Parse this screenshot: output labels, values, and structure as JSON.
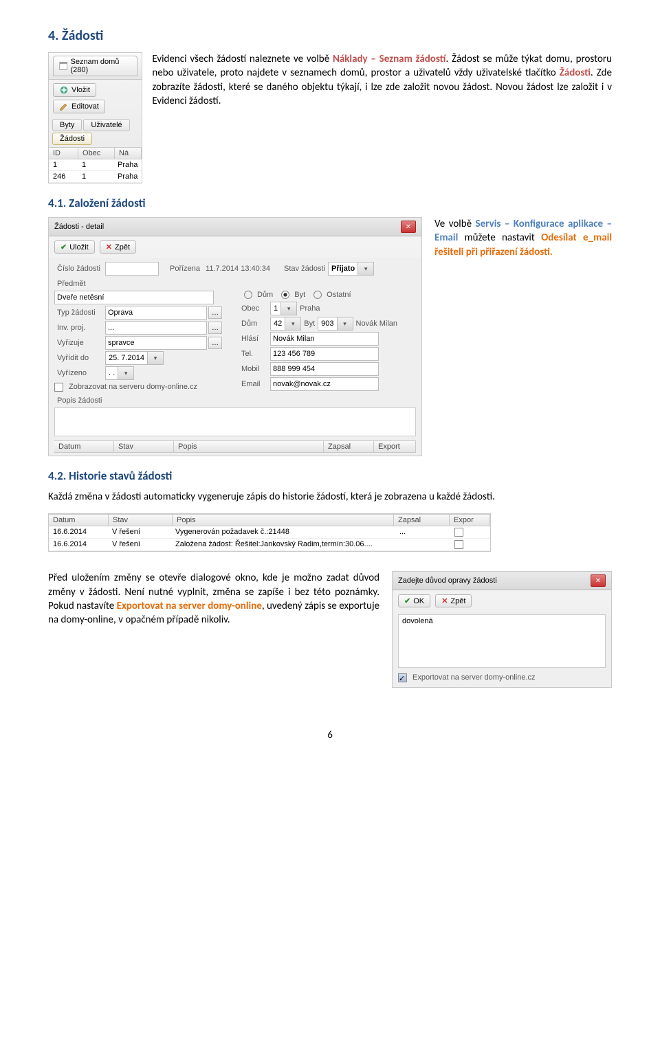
{
  "doc": {
    "h1": "4. Žádosti",
    "p1a": "Evidenci všech žádostí naleznete ve volbě ",
    "p1b": "Náklady – Seznam žádostí",
    "p1c": ". Žádost se může týkat domu, prostoru nebo uživatele, proto najdete v seznamech domů, prostor a uživatelů vždy uživatelské tlačítko ",
    "p1d": "Žádosti",
    "p1e": ". Zde zobrazíte žádosti, které se daného objektu týkají, i lze zde založit novou žádost. Novou žádost lze založit i v Evidenci žádostí.",
    "h2": "4.1. Založení žádosti",
    "p2a": "Ve volbě ",
    "p2b": "Servis – Konfigurace aplikace – Email",
    "p2c": " můžete nastavit ",
    "p2d": "Odesílat e_mail řešiteli při přiřazení žádosti.",
    "h3": "4.2. Historie stavů žádosti",
    "p3": "Každá změna v žádosti automaticky vygeneruje zápis do historie žádostí, která je zobrazena u každé žádosti.",
    "p4a": "Před uložením změny se otevře dialogové okno, kde je možno zadat důvod změny v žádosti. Není nutné vyplnit, změna se zapíše i bez této poznámky. Pokud nastavíte ",
    "p4b": "Exportovat na server domy-online",
    "p4c": ", uvedený zápis se exportuje na domy-online, v opačném případě nikoliv.",
    "pnum": "6"
  },
  "panel": {
    "tabtitle": "Seznam domů (280)",
    "vlozit": "Vložit",
    "editovat": "Editovat",
    "tabs": [
      "Byty",
      "Uživatelé",
      "Žádosti"
    ],
    "sel": 2,
    "cols": [
      "ID",
      "Obec",
      "Ná"
    ],
    "rows": [
      [
        "1",
        "1",
        "Praha"
      ],
      [
        "246",
        "1",
        "Praha"
      ]
    ]
  },
  "detail": {
    "title": "Žádosti - detail",
    "ulozit": "Uložit",
    "zpet": "Zpět",
    "f_cislo_l": "Číslo žádosti",
    "f_cislo_v": "",
    "f_porizena_l": "Pořízena",
    "f_porizena_v": "11.7.2014 13:40:34",
    "f_stav_l": "Stav žádosti",
    "f_stav_v": "Přijato",
    "f_predmet_l": "Předmět",
    "f_predmet_v": "Dveře netěsní",
    "rad_dum": "Dům",
    "rad_byt": "Byt",
    "rad_ost": "Ostatní",
    "f_typ_l": "Typ žádosti",
    "f_typ_v": "Oprava",
    "f_obec_l": "Obec",
    "f_obec_v": "1",
    "f_obec_v2": "Praha",
    "f_inv_l": "Inv. proj.",
    "f_inv_v": "...",
    "f_dum_l": "Dům",
    "f_dum_v": "42",
    "f_byt_l": "Byt",
    "f_byt_v": "903",
    "f_byt_name": "Novák Milan",
    "f_vyrizuje_l": "Vyřizuje",
    "f_vyrizuje_v": "spravce",
    "f_hlasi_l": "Hlásí",
    "f_hlasi_v": "Novák Milan",
    "f_vyridit_l": "Vyřídit do",
    "f_vyridit_v": "25. 7.2014",
    "f_tel_l": "Tel.",
    "f_tel_v": "123 456 789",
    "f_vyrizeno_l": "Vyřízeno",
    "f_vyrizeno_v": ". .",
    "f_mobil_l": "Mobil",
    "f_mobil_v": "888 999 454",
    "chk_zobraz": "Zobrazovat na serveru domy-online.cz",
    "f_email_l": "Email",
    "f_email_v": "novak@novak.cz",
    "popis_l": "Popis žádosti",
    "hcols": [
      "Datum",
      "Stav",
      "Popis",
      "Zapsal",
      "Export"
    ]
  },
  "hist": {
    "cols": [
      "Datum",
      "Stav",
      "Popis",
      "Zapsal",
      "Expor"
    ],
    "rows": [
      [
        "16.6.2014",
        "V řešení",
        "Vygenerován požadavek č.:21448",
        "...",
        ""
      ],
      [
        "16.6.2014",
        "V řešení",
        "Založena žádost: Řešitel:Jankovský Radim,termín:30.06....",
        "",
        ""
      ]
    ]
  },
  "dlg": {
    "title": "Zadejte důvod opravy žádosti",
    "ok": "OK",
    "zpet": "Zpět",
    "value": "dovolená",
    "chk": "Exportovat na server domy-online.cz"
  }
}
